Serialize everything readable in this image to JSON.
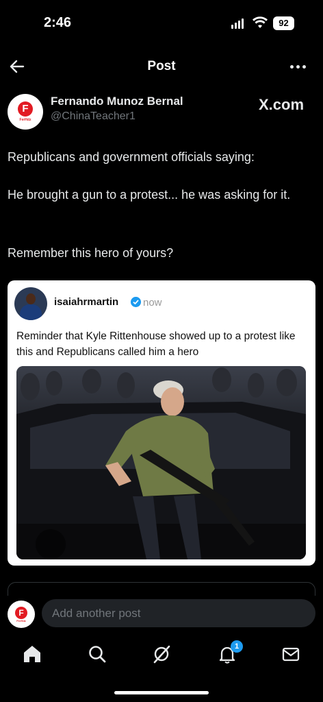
{
  "status": {
    "time": "2:46",
    "battery": "92"
  },
  "header": {
    "title": "Post"
  },
  "post": {
    "author_name": "Fernando Munoz Bernal",
    "author_handle": "@ChinaTeacher1",
    "avatar_letter": "F",
    "avatar_sub": "FerHdz",
    "source_label": "X.com",
    "paragraphs": [
      "Republicans and government officials saying:",
      "He brought a gun to a protest... he was asking for it.",
      "Remember this hero of yours?"
    ]
  },
  "embed": {
    "username": "isaiahrmartin",
    "time": "now",
    "text": "Reminder that Kyle Rittenhouse showed up to a protest like this and Republicans called him a hero"
  },
  "reply": {
    "placeholder": "Add another post"
  },
  "tabbar": {
    "notification_count": "1"
  },
  "icons": [
    "back-arrow-icon",
    "more-icon",
    "verified-icon",
    "home-icon",
    "search-icon",
    "grok-icon",
    "notifications-icon",
    "messages-icon"
  ],
  "colors": {
    "accent": "#1d9bf0",
    "background": "#000000",
    "brand_red": "#e21b23"
  }
}
